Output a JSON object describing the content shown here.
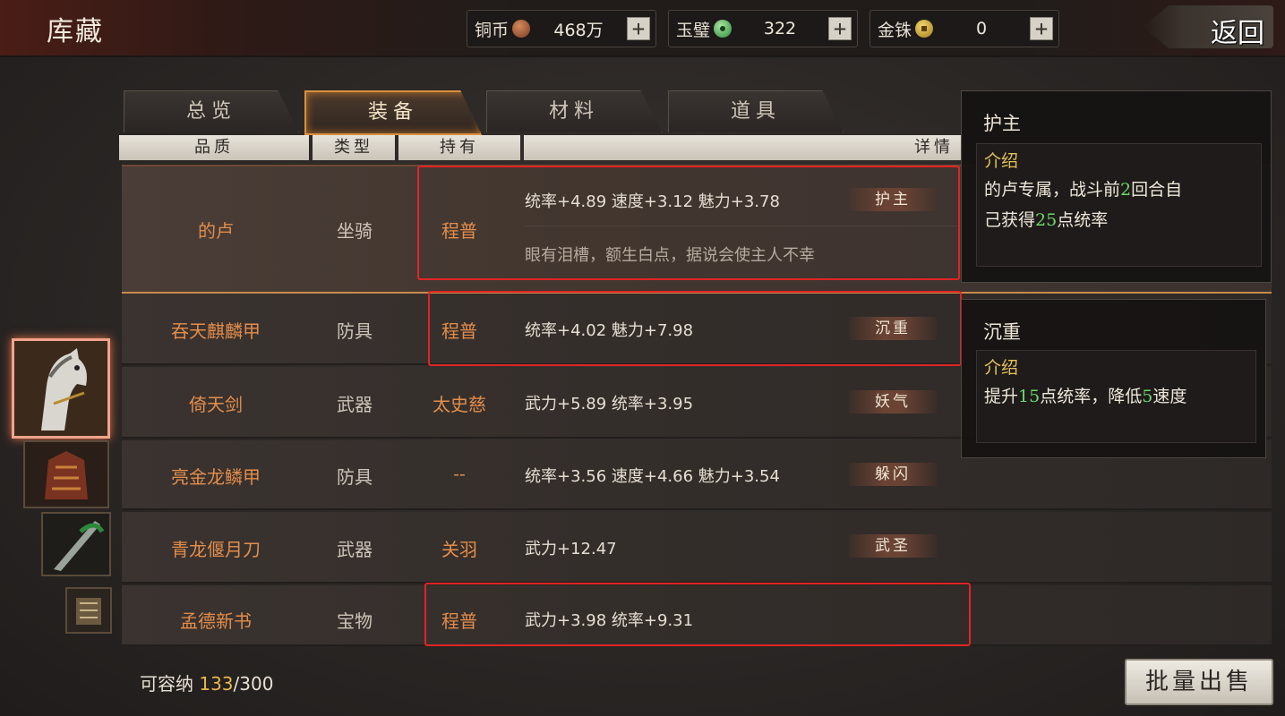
{
  "header": {
    "title": "库藏",
    "back_label": "返回"
  },
  "currencies": [
    {
      "label": "铜币",
      "value": "468万",
      "icon": "copper-coin-icon",
      "plus": "+"
    },
    {
      "label": "玉璧",
      "value": "322",
      "icon": "jade-disc-icon",
      "plus": "+"
    },
    {
      "label": "金铢",
      "value": "0",
      "icon": "gold-coin-icon",
      "plus": "+"
    }
  ],
  "tabs": [
    {
      "label": "总览",
      "active": false
    },
    {
      "label": "装备",
      "active": true
    },
    {
      "label": "材料",
      "active": false
    },
    {
      "label": "道具",
      "active": false
    }
  ],
  "columns": {
    "quality": "品质",
    "type": "类型",
    "holder": "持有",
    "detail": "详情"
  },
  "rows": [
    {
      "name": "的卢",
      "type": "坐骑",
      "holder": "程普",
      "stats": "统率+4.89  速度+3.12  魅力+3.78",
      "trait": "护主",
      "desc": "眼有泪槽，额生白点，据说会使主人不幸"
    },
    {
      "name": "吞天麒麟甲",
      "type": "防具",
      "holder": "程普",
      "stats": "统率+4.02  魅力+7.98",
      "trait": "沉重"
    },
    {
      "name": "倚天剑",
      "type": "武器",
      "holder": "太史慈",
      "stats": "武力+5.89  统率+3.95",
      "trait": "妖气"
    },
    {
      "name": "亮金龙鳞甲",
      "type": "防具",
      "holder": "--",
      "stats": "统率+3.56  速度+4.66  魅力+3.54",
      "trait": "躲闪"
    },
    {
      "name": "青龙偃月刀",
      "type": "武器",
      "holder": "关羽",
      "stats": "武力+12.47",
      "trait": "武圣"
    },
    {
      "name": "孟德新书",
      "type": "宝物",
      "holder": "程普",
      "stats": "武力+3.98  统率+9.31"
    }
  ],
  "tooltips": {
    "huzhu": {
      "title": "护主",
      "label": "介绍",
      "text_a": "的卢专属，战斗前",
      "num_a": "2",
      "text_b": "回合自",
      "text_c": "己获得",
      "num_b": "25",
      "text_d": "点统率"
    },
    "chenzhong": {
      "title": "沉重",
      "label": "介绍",
      "text_a": "提升",
      "num_a": "15",
      "text_b": "点统率，降低",
      "num_b": "5",
      "text_c": "速度"
    }
  },
  "footer": {
    "capacity_label": "可容纳",
    "capacity_used": "133",
    "capacity_total": "/300",
    "sell_label": "批量出售"
  },
  "colors": {
    "accent_orange": "#e48d4a",
    "highlight_red": "#e02424",
    "number_green": "#6fd86a"
  }
}
